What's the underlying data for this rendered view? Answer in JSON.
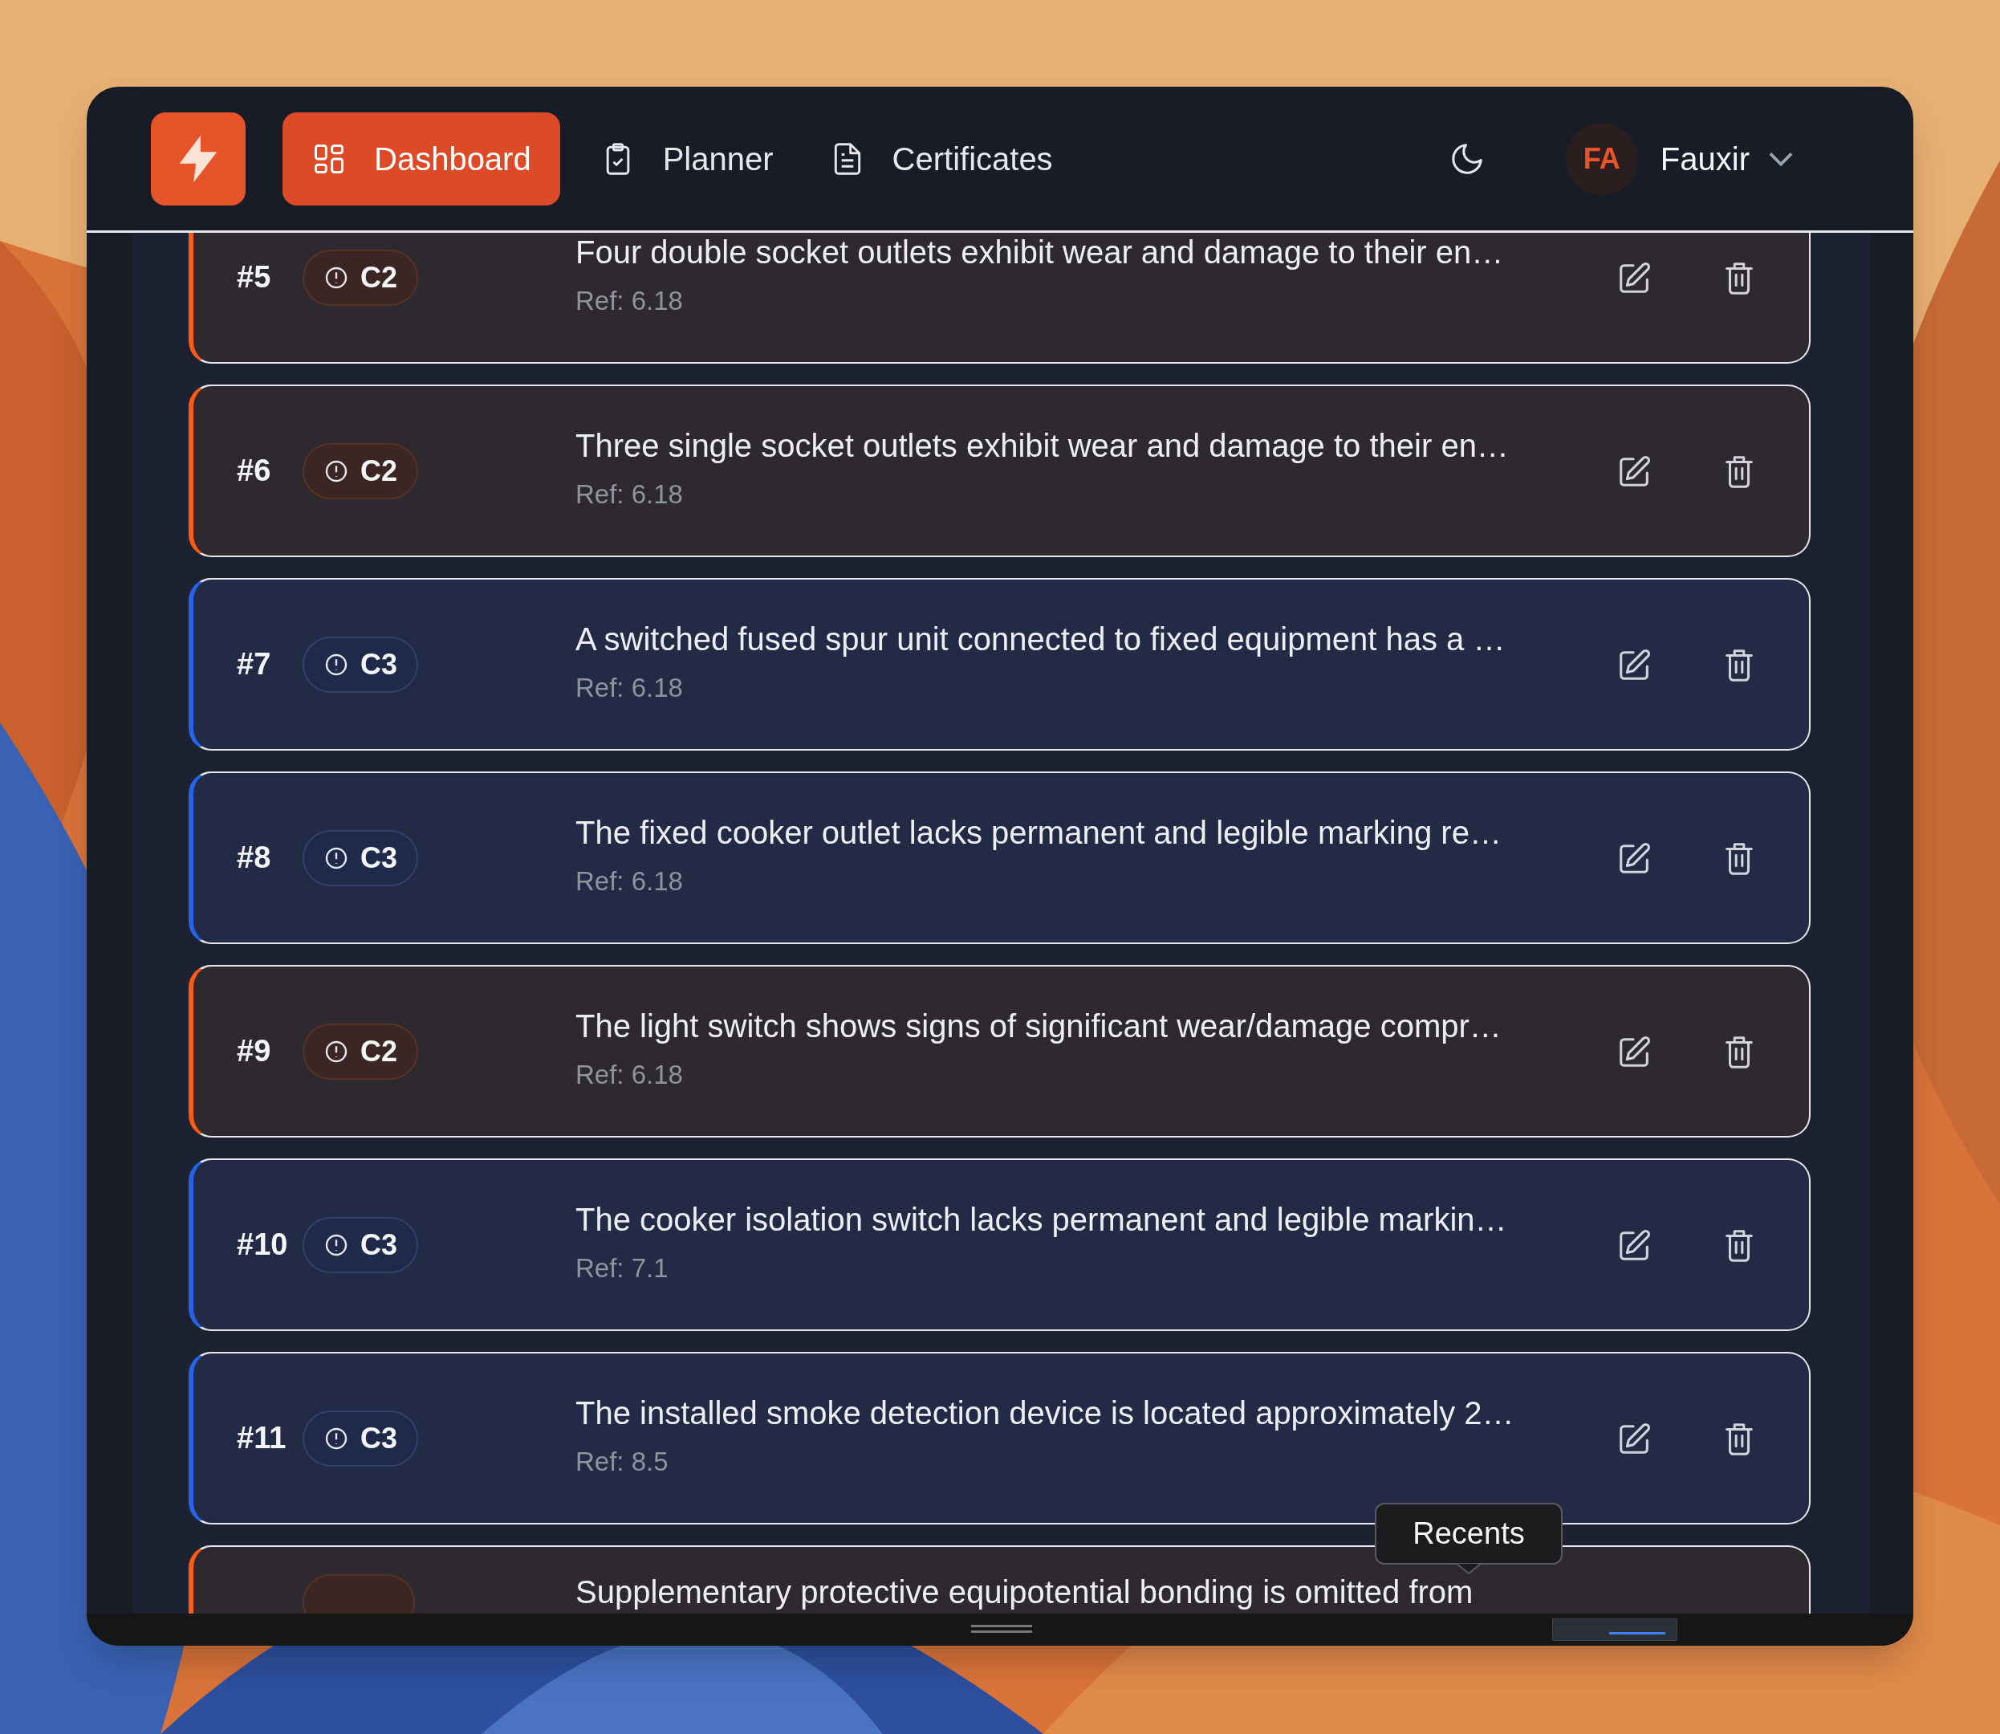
{
  "nav": {
    "items": [
      {
        "label": "Dashboard",
        "kind": "grid",
        "selected": true
      },
      {
        "label": "Planner",
        "kind": "clipboard",
        "selected": false
      },
      {
        "label": "Certificates",
        "kind": "document",
        "selected": false
      }
    ],
    "user": {
      "initials": "FA",
      "name": "Fauxir"
    }
  },
  "observations": [
    {
      "number": "#5",
      "kind": "c2",
      "code": "C2",
      "text": "Four double socket outlets exhibit wear and damage to their en…",
      "ref": "Ref: 6.18"
    },
    {
      "number": "#6",
      "kind": "c2",
      "code": "C2",
      "text": "Three single socket outlets exhibit wear and damage to their en…",
      "ref": "Ref: 6.18"
    },
    {
      "number": "#7",
      "kind": "c3",
      "code": "C3",
      "text": "A switched fused spur unit connected to fixed equipment has a …",
      "ref": "Ref: 6.18"
    },
    {
      "number": "#8",
      "kind": "c3",
      "code": "C3",
      "text": "The fixed cooker outlet lacks permanent and legible marking re…",
      "ref": "Ref: 6.18"
    },
    {
      "number": "#9",
      "kind": "c2",
      "code": "C2",
      "text": "The light switch shows signs of significant wear/damage compr…",
      "ref": "Ref: 6.18"
    },
    {
      "number": "#10",
      "kind": "c3",
      "code": "C3",
      "text": "The cooker isolation switch lacks permanent and legible markin…",
      "ref": "Ref: 7.1"
    },
    {
      "number": "#11",
      "kind": "c3",
      "code": "C3",
      "text": "The installed smoke detection device is located approximately 2…",
      "ref": "Ref: 8.5"
    },
    {
      "kind": "c2",
      "text": "Supplementary protective equipotential bonding is omitted from"
    }
  ],
  "tooltip": "Recents"
}
